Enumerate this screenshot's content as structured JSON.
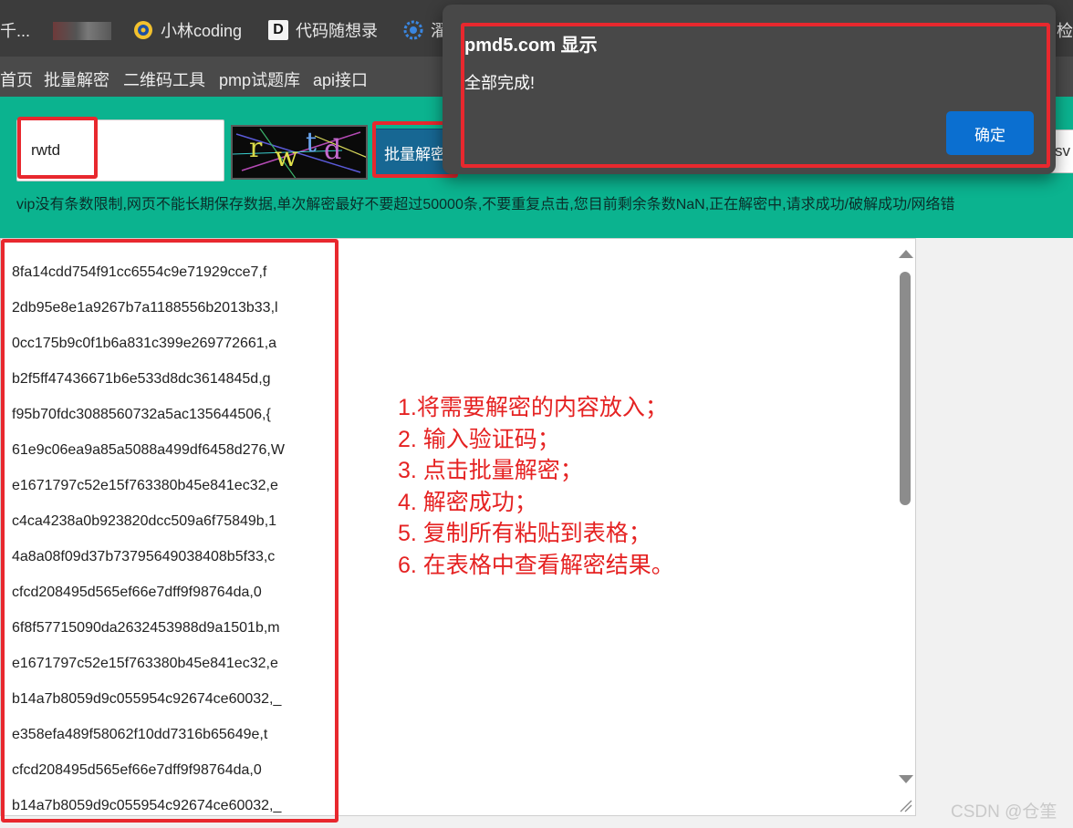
{
  "bookmarks": [
    {
      "label": "千..."
    },
    {
      "label": "小林coding",
      "icon": "xiaolin-logo-icon"
    },
    {
      "label": "代码随想录",
      "icon": "d-logo-icon"
    },
    {
      "label": "濯",
      "icon": "gear-logo-icon"
    },
    {
      "label": "检"
    }
  ],
  "site_nav": [
    "首页",
    "批量解密",
    "二维码工具",
    "pmp试题库",
    "api接口"
  ],
  "form": {
    "captcha_value": "rwtd",
    "captcha_letters": [
      "r",
      "w",
      "t",
      "d"
    ],
    "batch_button": "批量解密",
    "csv_button": "sv"
  },
  "notice": "vip没有条数限制,网页不能长期保存数据,单次解密最好不要超过50000条,不要重复点击,您目前剩余条数NaN,正在解密中,请求成功/破解成功/网络错",
  "results": [
    "8fa14cdd754f91cc6554c9e71929cce7,f",
    "2db95e8e1a9267b7a1188556b2013b33,l",
    "0cc175b9c0f1b6a831c399e269772661,a",
    "b2f5ff47436671b6e533d8dc3614845d,g",
    "f95b70fdc3088560732a5ac135644506,{",
    "61e9c06ea9a85a5088a499df6458d276,W",
    "e1671797c52e15f763380b45e841ec32,e",
    "c4ca4238a0b923820dcc509a6f75849b,1",
    "4a8a08f09d37b73795649038408b5f33,c",
    "cfcd208495d565ef66e7dff9f98764da,0",
    "6f8f57715090da2632453988d9a1501b,m",
    "e1671797c52e15f763380b45e841ec32,e",
    "b14a7b8059d9c055954c92674ce60032,_",
    "e358efa489f58062f10dd7316b65649e,t",
    "cfcd208495d565ef66e7dff9f98764da,0",
    "b14a7b8059d9c055954c92674ce60032,_"
  ],
  "instructions": [
    "1.将需要解密的内容放入；",
    "2. 输入验证码；",
    "3. 点击批量解密；",
    "4. 解密成功；",
    "5. 复制所有粘贴到表格；",
    "6. 在表格中查看解密结果。"
  ],
  "dialog": {
    "title": "pmd5.com 显示",
    "message": "全部完成!",
    "ok_label": "确定"
  },
  "watermark": "CSDN @仓筀",
  "colors": {
    "accent_green": "#0bb38f",
    "annotation_red": "#e8282e",
    "dialog_button": "#0b6fd0"
  }
}
